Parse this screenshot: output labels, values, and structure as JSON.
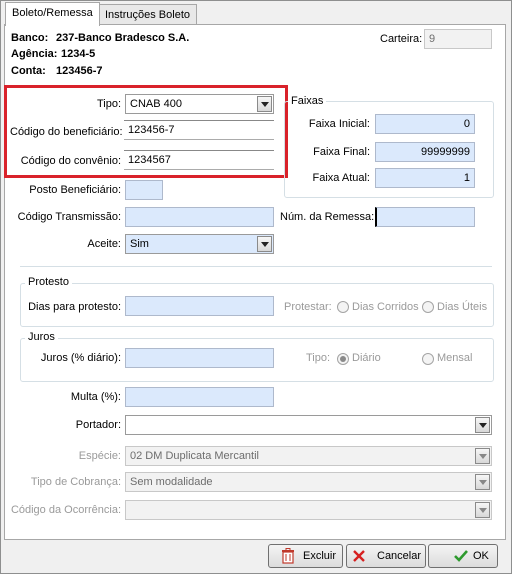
{
  "tabs": [
    "Boleto/Remessa",
    "Instruções Boleto"
  ],
  "header": {
    "banco_label": "Banco:",
    "banco_value": "237-Banco Bradesco S.A.",
    "agencia_label": "Agência:",
    "agencia_value": "1234-5",
    "conta_label": "Conta:",
    "conta_value": "123456-7",
    "carteira_label": "Carteira:",
    "carteira_value": "9"
  },
  "form": {
    "tipo_label": "Tipo:",
    "tipo_value": "CNAB 400",
    "cod_beneficiario_label": "Código do beneficiário:",
    "cod_beneficiario_value": "123456-7",
    "cod_convenio_label": "Código do convênio:",
    "cod_convenio_value": "1234567",
    "posto_label": "Posto Beneficiário:",
    "posto_value": "",
    "transmissao_label": "Código Transmissão:",
    "transmissao_value": "",
    "remessa_label": "Núm. da Remessa:",
    "remessa_value": "",
    "aceite_label": "Aceite:",
    "aceite_value": "Sim"
  },
  "faixas": {
    "title": "Faixas",
    "inicial_label": "Faixa Inicial:",
    "inicial_value": "0",
    "final_label": "Faixa Final:",
    "final_value": "99999999",
    "atual_label": "Faixa Atual:",
    "atual_value": "1"
  },
  "protesto": {
    "title": "Protesto",
    "dias_label": "Dias para protesto:",
    "dias_value": "",
    "protestar_label": "Protestar:",
    "opt_corridos": "Dias Corridos",
    "opt_uteis": "Dias Úteis"
  },
  "juros": {
    "title": "Juros",
    "juros_label": "Juros (% diário):",
    "juros_value": "",
    "tipo_label": "Tipo:",
    "opt_diario": "Diário",
    "opt_mensal": "Mensal"
  },
  "extra": {
    "multa_label": "Multa (%):",
    "multa_value": "",
    "portador_label": "Portador:",
    "portador_value": "",
    "especie_label": "Espécie:",
    "especie_value": "02 DM Duplicata Mercantil",
    "tipo_cobranca_label": "Tipo de Cobrança:",
    "tipo_cobranca_value": "Sem modalidade",
    "ocorrencia_label": "Código da Ocorrência:",
    "ocorrencia_value": ""
  },
  "buttons": {
    "excluir": "Excluir",
    "cancelar": "Cancelar",
    "ok": "OK"
  },
  "colors": {
    "highlight": "#d9222a",
    "field_bg": "#dbe9fc",
    "ok_green": "#2e9a2e",
    "cancel_red": "#d62020"
  },
  "icons": {
    "excluir": "trash-icon",
    "cancelar": "x-icon",
    "ok": "check-icon"
  }
}
